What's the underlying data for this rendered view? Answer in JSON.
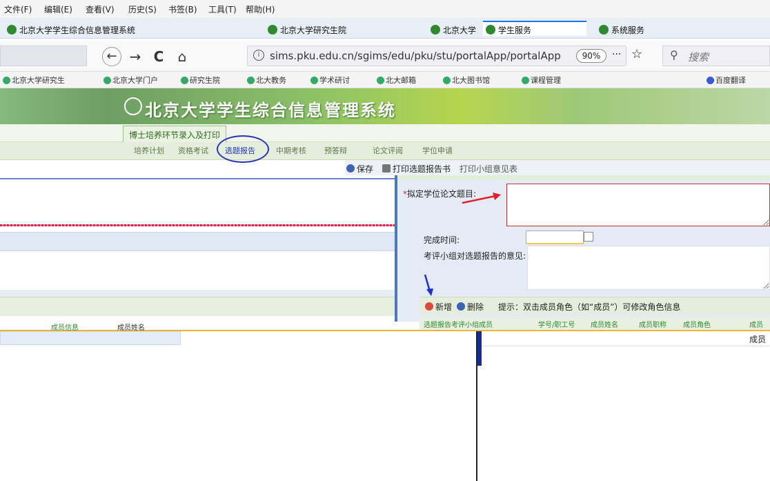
{
  "menubar": {
    "items": [
      "文件(F)",
      "编辑(E)",
      "查看(V)",
      "历史(S)",
      "书签(B)",
      "工具(T)",
      "帮助(H)"
    ]
  },
  "tabs": [
    {
      "label": "北京大学学生综合信息管理系统",
      "active": false
    },
    {
      "label": "北京大学研究生院",
      "active": false
    },
    {
      "label": "北京大学",
      "active": true
    },
    {
      "label": "学生服务",
      "active": false
    },
    {
      "label": "系统服务",
      "active": false
    }
  ],
  "toolbar": {
    "back_icon": "←",
    "forward_icon": "→",
    "reload_icon": "C",
    "home_icon": "⌂",
    "url": "sims.pku.edu.cn/sgims/edu/pku/stu/portalApp/portalApp",
    "zoom": "90%",
    "more_icon": "···",
    "star_icon": "☆",
    "search_placeholder": "搜索"
  },
  "bookmarks": [
    "北京大学研究生",
    "北京大学门户",
    "研究生院",
    "北大教务",
    "学术研讨",
    "北大邮箱",
    "北大图书馆",
    "课程管理",
    "百度翻译"
  ],
  "banner": {
    "title": "北京大学学生综合信息管理系统"
  },
  "module": {
    "tab_label": "博士培养环节录入及打印"
  },
  "subtabs": [
    "培养计划",
    "资格考试",
    "选题报告",
    "中期考核",
    "预答辩",
    "论文评阅",
    "学位申请"
  ],
  "form_toolbar": {
    "save": "保存",
    "print": "打印选题报告书",
    "print_opinion": "打印小组意见表"
  },
  "form": {
    "required_mark": "*",
    "title_label": "拟定学位论文题目:",
    "title_value": "",
    "time_label": "完成时间:",
    "time_value": "",
    "opinion_label": "考评小组对选题报告的意见:",
    "opinion_value": ""
  },
  "members": {
    "add": "新增",
    "delete": "删除",
    "hint": "提示：双击成员角色（如“成员”）可修改角色信息",
    "columns": [
      "选题报告考评小组成员",
      "学号/职工号",
      "成员姓名",
      "成员职称",
      "成员角色",
      "成员"
    ],
    "rows": [
      {
        "role": "成员"
      }
    ]
  },
  "left_grid": {
    "columns": [
      "成员信息",
      "成员姓名"
    ]
  }
}
